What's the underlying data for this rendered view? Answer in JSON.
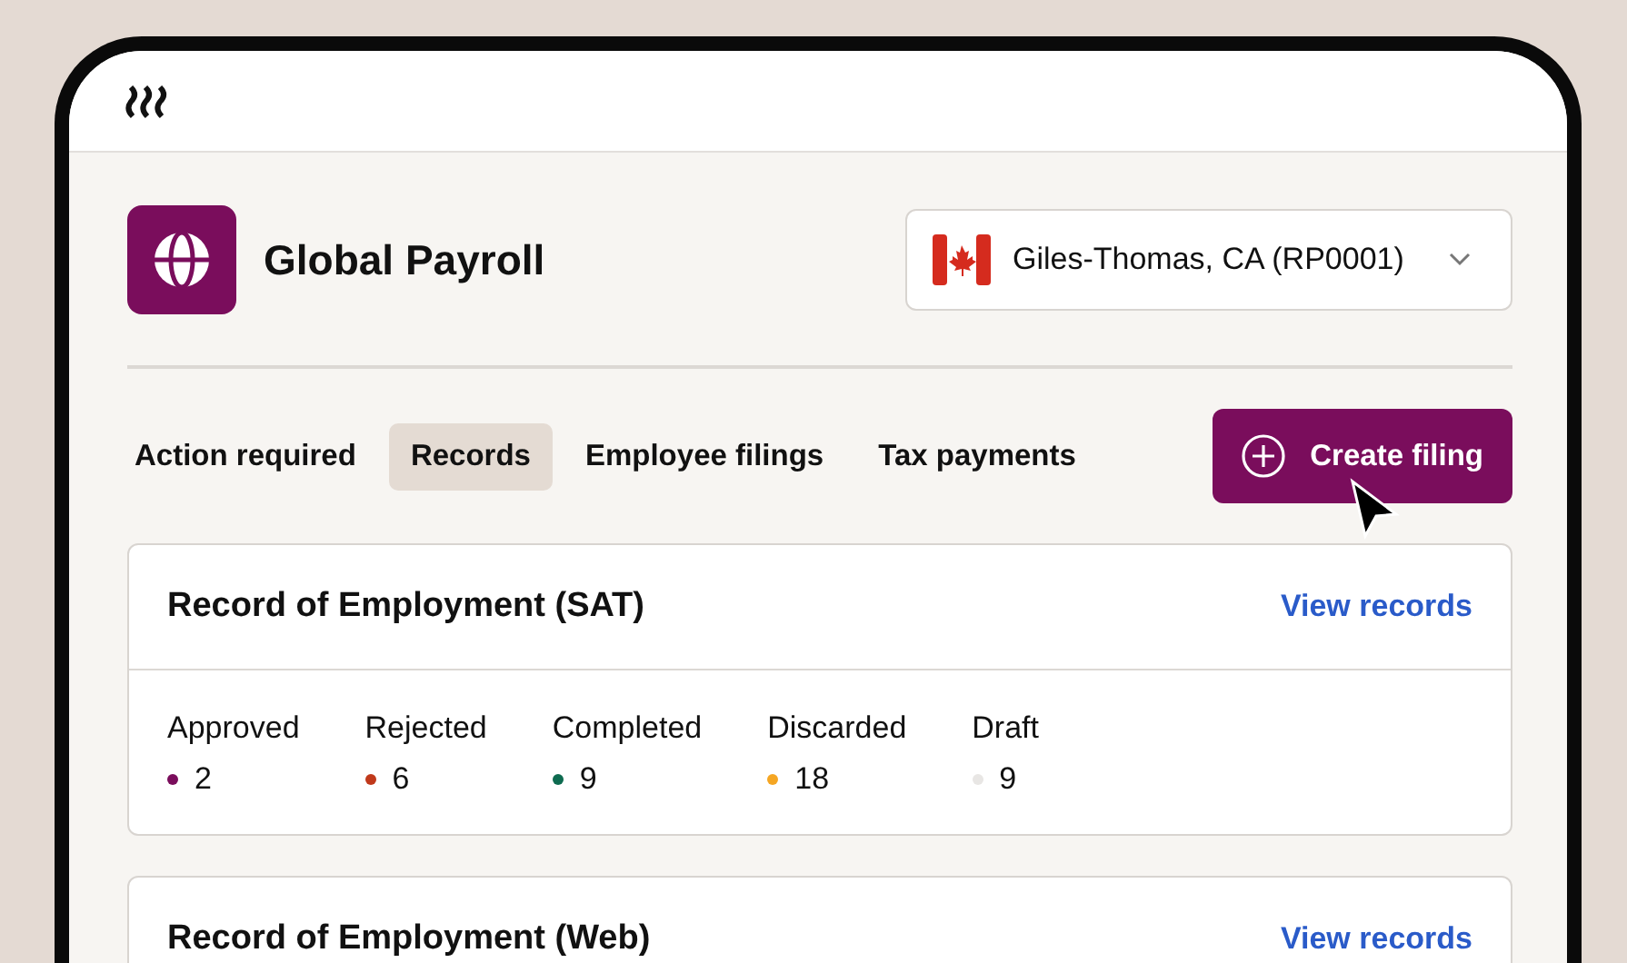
{
  "app": {
    "title": "Global Payroll"
  },
  "entity_select": {
    "value": "Giles-Thomas, CA (RP0001)"
  },
  "tabs": [
    {
      "label": "Action required",
      "selected": false
    },
    {
      "label": "Records",
      "selected": true
    },
    {
      "label": "Employee filings",
      "selected": false
    },
    {
      "label": "Tax payments",
      "selected": false
    }
  ],
  "create_button": {
    "label": "Create filing"
  },
  "cards": [
    {
      "title": "Record of Employment (SAT)",
      "link": "View records",
      "stats": [
        {
          "label": "Approved",
          "value": "2",
          "color": "#7a0d5c"
        },
        {
          "label": "Rejected",
          "value": "6",
          "color": "#c0391b"
        },
        {
          "label": "Completed",
          "value": "9",
          "color": "#0e6b50"
        },
        {
          "label": "Discarded",
          "value": "18",
          "color": "#f5a623"
        },
        {
          "label": "Draft",
          "value": "9",
          "color": "#e8e6e4"
        }
      ]
    },
    {
      "title": "Record of Employment (Web)",
      "link": "View records"
    }
  ]
}
